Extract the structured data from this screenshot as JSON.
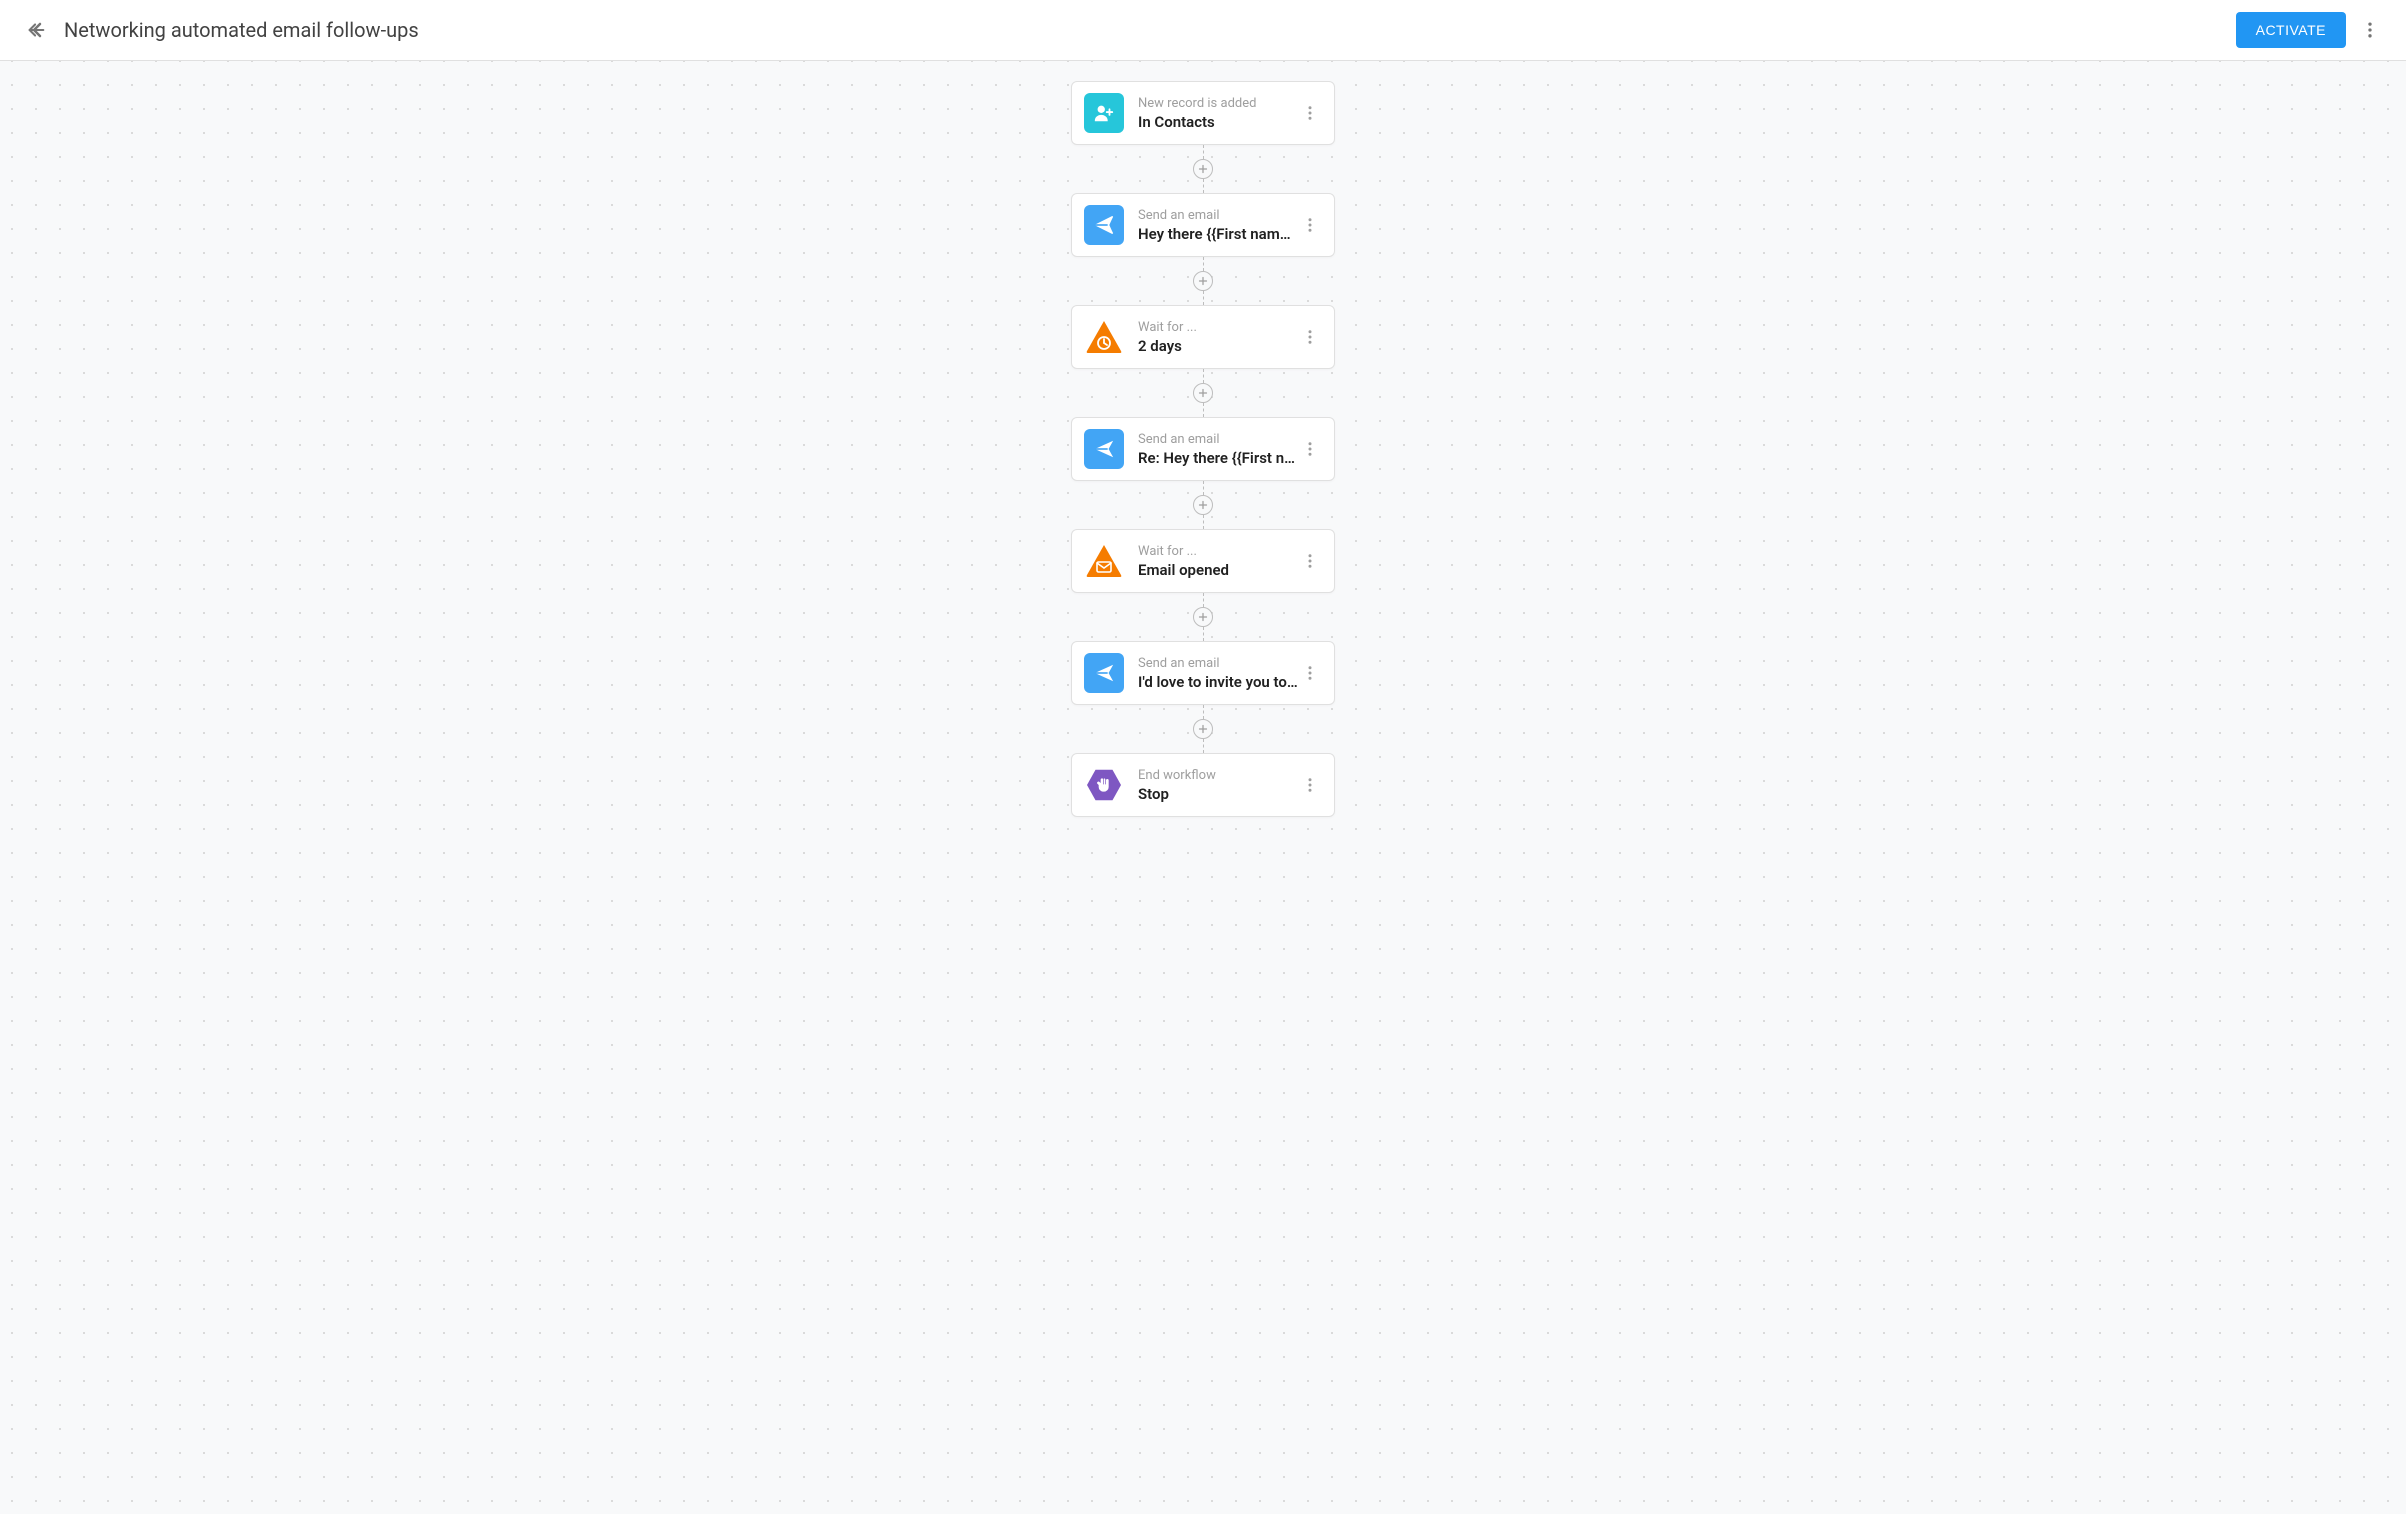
{
  "header": {
    "title": "Networking automated email follow-ups",
    "activate_label": "ACTIVATE"
  },
  "workflow": {
    "nodes": [
      {
        "type": "trigger",
        "icon": "person-add",
        "color": "teal",
        "label": "New record is added",
        "value": "In Contacts"
      },
      {
        "type": "email",
        "icon": "send",
        "color": "blue",
        "label": "Send an email",
        "value": "Hey there {{First name…"
      },
      {
        "type": "wait",
        "icon": "triangle-clock",
        "color": "orange",
        "label": "Wait for ...",
        "value": "2 days"
      },
      {
        "type": "email",
        "icon": "send",
        "color": "blue",
        "label": "Send an email",
        "value": "Re: Hey there {{First n…"
      },
      {
        "type": "wait",
        "icon": "triangle-mail",
        "color": "orange",
        "label": "Wait for ...",
        "value": "Email opened"
      },
      {
        "type": "email",
        "icon": "send",
        "color": "blue",
        "label": "Send an email",
        "value": "I'd love to invite you to…"
      },
      {
        "type": "end",
        "icon": "hand",
        "color": "purple",
        "label": "End workflow",
        "value": "Stop"
      }
    ]
  }
}
